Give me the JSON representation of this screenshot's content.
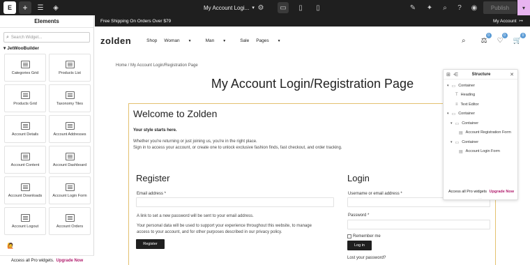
{
  "topbar": {
    "logo": "E",
    "add": "+",
    "doc_title": "My Account Logi...",
    "publish": "Publish"
  },
  "panel": {
    "title": "Elements",
    "search_placeholder": "Search Widget...",
    "category": "JetWooBuilder",
    "widgets": [
      {
        "label": "Categories Grid"
      },
      {
        "label": "Products List"
      },
      {
        "label": "Products Grid"
      },
      {
        "label": "Taxonomy Tiles"
      },
      {
        "label": "Account Details"
      },
      {
        "label": "Account Addresses"
      },
      {
        "label": "Account Content"
      },
      {
        "label": "Account Dashboard"
      },
      {
        "label": "Account Downloads"
      },
      {
        "label": "Account Login Form"
      },
      {
        "label": "Account Logout"
      },
      {
        "label": "Account Orders"
      }
    ],
    "footer_text": "Access all Pro widgets.",
    "footer_link": "Upgrade Now"
  },
  "site": {
    "shipping": "Free Shipping On Orders Over $79",
    "account": "My Account",
    "logo": "zolden",
    "menu": [
      "Shop",
      "Woman",
      "Man",
      "Sale",
      "Pages"
    ],
    "badges": {
      "compare": "0",
      "wishlist": "0",
      "cart": "0"
    },
    "breadcrumb_home": "Home",
    "breadcrumb_sep": " / ",
    "breadcrumb_page": "My Account Login/Registration Page",
    "page_title": "My Account Login/Registration Page",
    "welcome": "Welcome to Zolden",
    "tagline": "Your style starts here.",
    "intro1": "Whether you're returning or just joining us, you're in the right place.",
    "intro2": "Sign in to access your account, or create one to unlock exclusive fashion finds, fast checkout, and order tracking.",
    "register": {
      "title": "Register",
      "email_label": "Email address *",
      "password_note": "A link to set a new password will be sent to your email address.",
      "privacy_1": "Your personal data will be used to support your experience throughout this website, to manage",
      "privacy_2": "access to your account, and for other purposes described in our privacy policy.",
      "button": "Register"
    },
    "login": {
      "title": "Login",
      "username_label": "Username or email address *",
      "password_label": "Password *",
      "remember": "Remember me",
      "button": "Log in",
      "lost": "Lost your password?"
    }
  },
  "structure": {
    "title": "Structure",
    "items": [
      {
        "label": "Container"
      },
      {
        "label": "Heading"
      },
      {
        "label": "Text Editor"
      },
      {
        "label": "Container"
      },
      {
        "label": "Container"
      },
      {
        "label": "Account Registration Form"
      },
      {
        "label": "Container"
      },
      {
        "label": "Account Login Form"
      }
    ],
    "footer_text": "Access all Pro widgets",
    "footer_link": "Upgrade Now"
  }
}
